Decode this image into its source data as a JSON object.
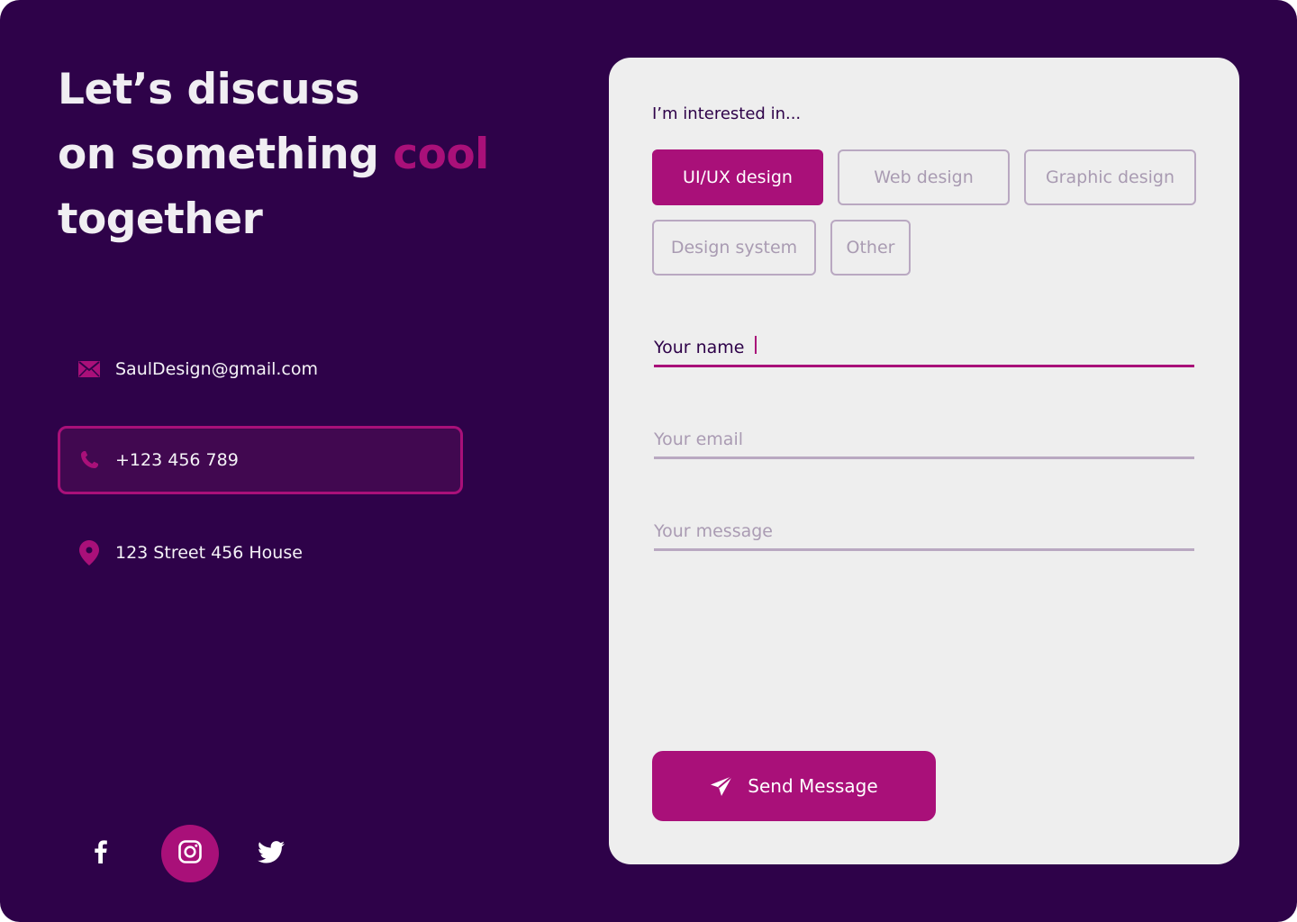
{
  "headline": {
    "line1": "Let’s discuss",
    "line2_prefix": "on something ",
    "line2_accent": "cool",
    "line3": "together"
  },
  "contacts": {
    "email": {
      "text": "SaulDesign@gmail.com",
      "icon": "mail-icon"
    },
    "phone": {
      "text": "+123 456 789",
      "icon": "phone-icon"
    },
    "address": {
      "text": "123 Street 456 House",
      "icon": "location-pin-icon"
    }
  },
  "socials": [
    {
      "icon": "facebook-icon"
    },
    {
      "icon": "instagram-icon"
    },
    {
      "icon": "twitter-icon"
    }
  ],
  "form": {
    "interest_label": "I’m interested in...",
    "chips": [
      {
        "label": "UI/UX design",
        "selected": true
      },
      {
        "label": "Web design",
        "selected": false
      },
      {
        "label": "Graphic design",
        "selected": false
      },
      {
        "label": "Design system",
        "selected": false
      },
      {
        "label": "Other",
        "selected": false
      }
    ],
    "name": {
      "value": "Your name",
      "placeholder": ""
    },
    "email": {
      "value": "",
      "placeholder": "Your email"
    },
    "message": {
      "value": "",
      "placeholder": "Your message"
    },
    "send_label": "Send Message"
  },
  "colors": {
    "background": "#2e0249",
    "accent": "#a91079",
    "card": "#eeeeee",
    "muted": "#b9a8c1"
  }
}
